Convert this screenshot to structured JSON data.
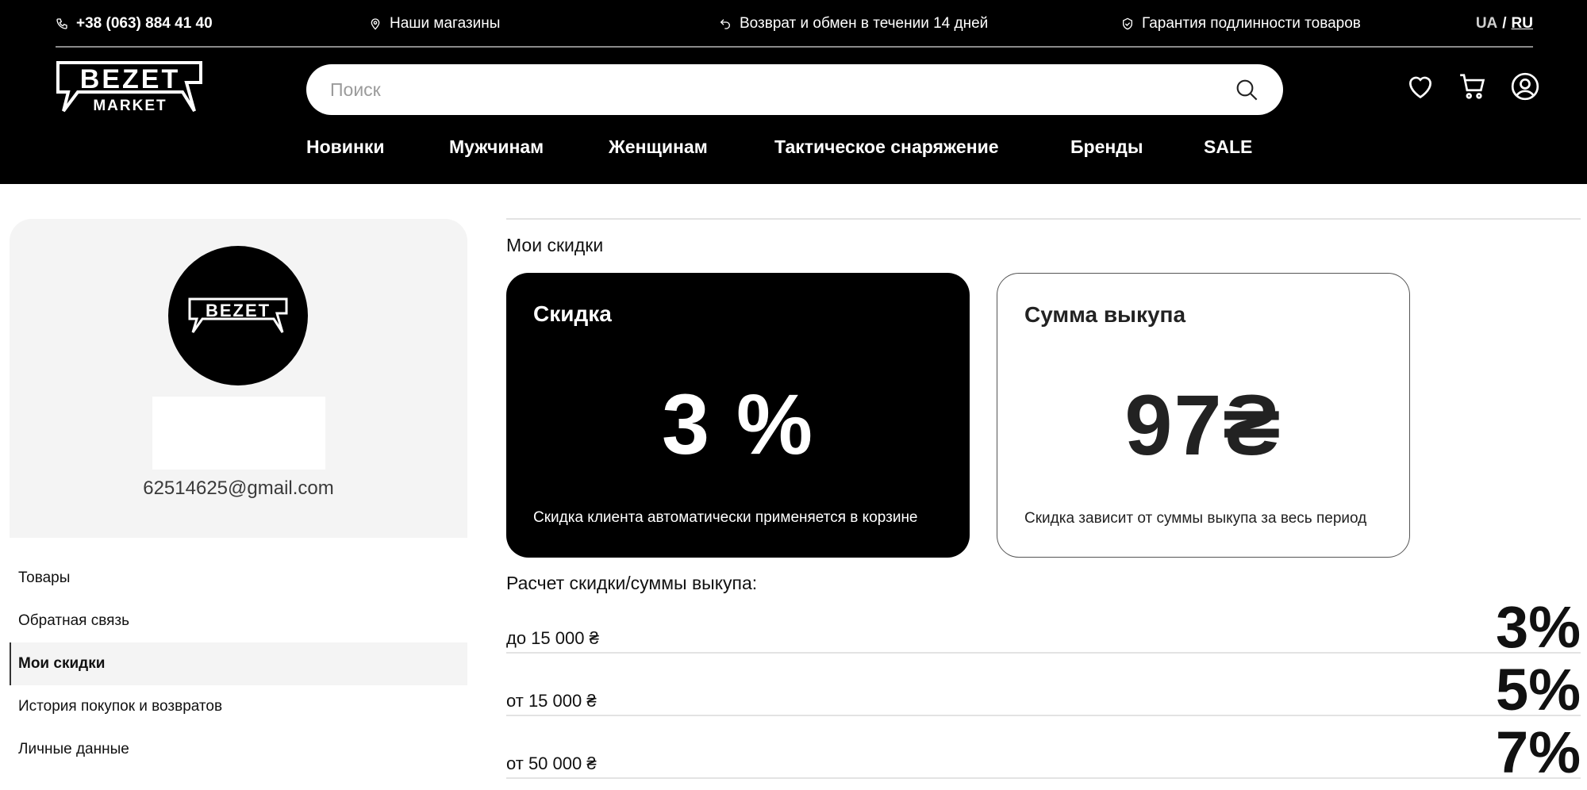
{
  "topbar": {
    "phone": "+38 (063) 884 41 40",
    "stores": "Наши магазины",
    "returns": "Возврат и обмен в течении 14 дней",
    "guarantee": "Гарантия подлинности товаров",
    "lang_ua": "UA",
    "lang_sep": "/",
    "lang_ru": "RU"
  },
  "logo": {
    "line1": "BEZET",
    "line2": "MARKET"
  },
  "search": {
    "placeholder": "Поиск"
  },
  "nav": [
    "Новинки",
    "Мужчинам",
    "Женщинам",
    "Тактическое снаряжение",
    "Бренды",
    "SALE"
  ],
  "profile": {
    "email": "62514625@gmail.com",
    "avatar_logo": "BEZET"
  },
  "menu": [
    {
      "label": "Товары",
      "active": false
    },
    {
      "label": "Обратная связь",
      "active": false
    },
    {
      "label": "Мои скидки",
      "active": true
    },
    {
      "label": "История покупок и возвратов",
      "active": false
    },
    {
      "label": "Личные данные",
      "active": false
    }
  ],
  "main": {
    "title": "Мои скидки",
    "discount_card": {
      "title": "Скидка",
      "value": "3 %",
      "note": "Скидка клиента автоматически применяется в корзине"
    },
    "sum_card": {
      "title": "Сумма выкупа",
      "value": "97₴",
      "note": "Скидка зависит от суммы выкупа за весь период"
    },
    "calc_title": "Расчет скидки/суммы выкупа:",
    "tiers": [
      {
        "label": "до 15 000 ₴",
        "percent": "3%"
      },
      {
        "label": "от 15 000 ₴",
        "percent": "5%"
      },
      {
        "label": "от 50 000 ₴",
        "percent": "7%"
      }
    ]
  },
  "colors": {
    "header_bg": "#000000",
    "panel_bg": "#f4f4f4",
    "text": "#1f1f1f"
  }
}
